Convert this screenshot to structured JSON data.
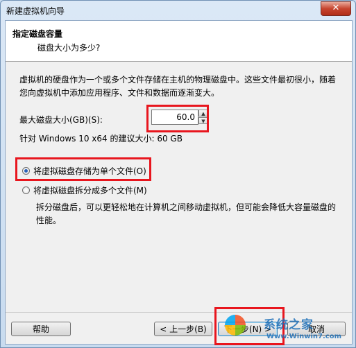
{
  "window": {
    "title": "新建虚拟机向导",
    "close_glyph": "✕"
  },
  "header": {
    "title": "指定磁盘容量",
    "subtitle": "磁盘大小为多少?"
  },
  "description": "虚拟机的硬盘作为一个或多个文件存储在主机的物理磁盘中。这些文件最初很小，随着您向虚拟机中添加应用程序、文件和数据而逐渐变大。",
  "disk_size": {
    "label": "最大磁盘大小(GB)(S):",
    "value": "60.0",
    "up_glyph": "▲",
    "down_glyph": "▼"
  },
  "recommendation": "针对 Windows 10 x64 的建议大小: 60 GB",
  "options": [
    {
      "label": "将虚拟磁盘存储为单个文件(O)",
      "checked": true
    },
    {
      "label": "将虚拟磁盘拆分成多个文件(M)",
      "checked": false
    }
  ],
  "split_description": "拆分磁盘后，可以更轻松地在计算机之间移动虚拟机，但可能会降低大容量磁盘的性能。",
  "buttons": {
    "help": "帮助",
    "back": "< 上一步(B)",
    "next": "下一步(N) >",
    "cancel": "取消"
  },
  "watermark": {
    "cn": "系统之家",
    "url": "Www.Winwin7.com"
  },
  "colors": {
    "highlight_box": "#e8161e",
    "radio_accent": "#2b62b8"
  }
}
